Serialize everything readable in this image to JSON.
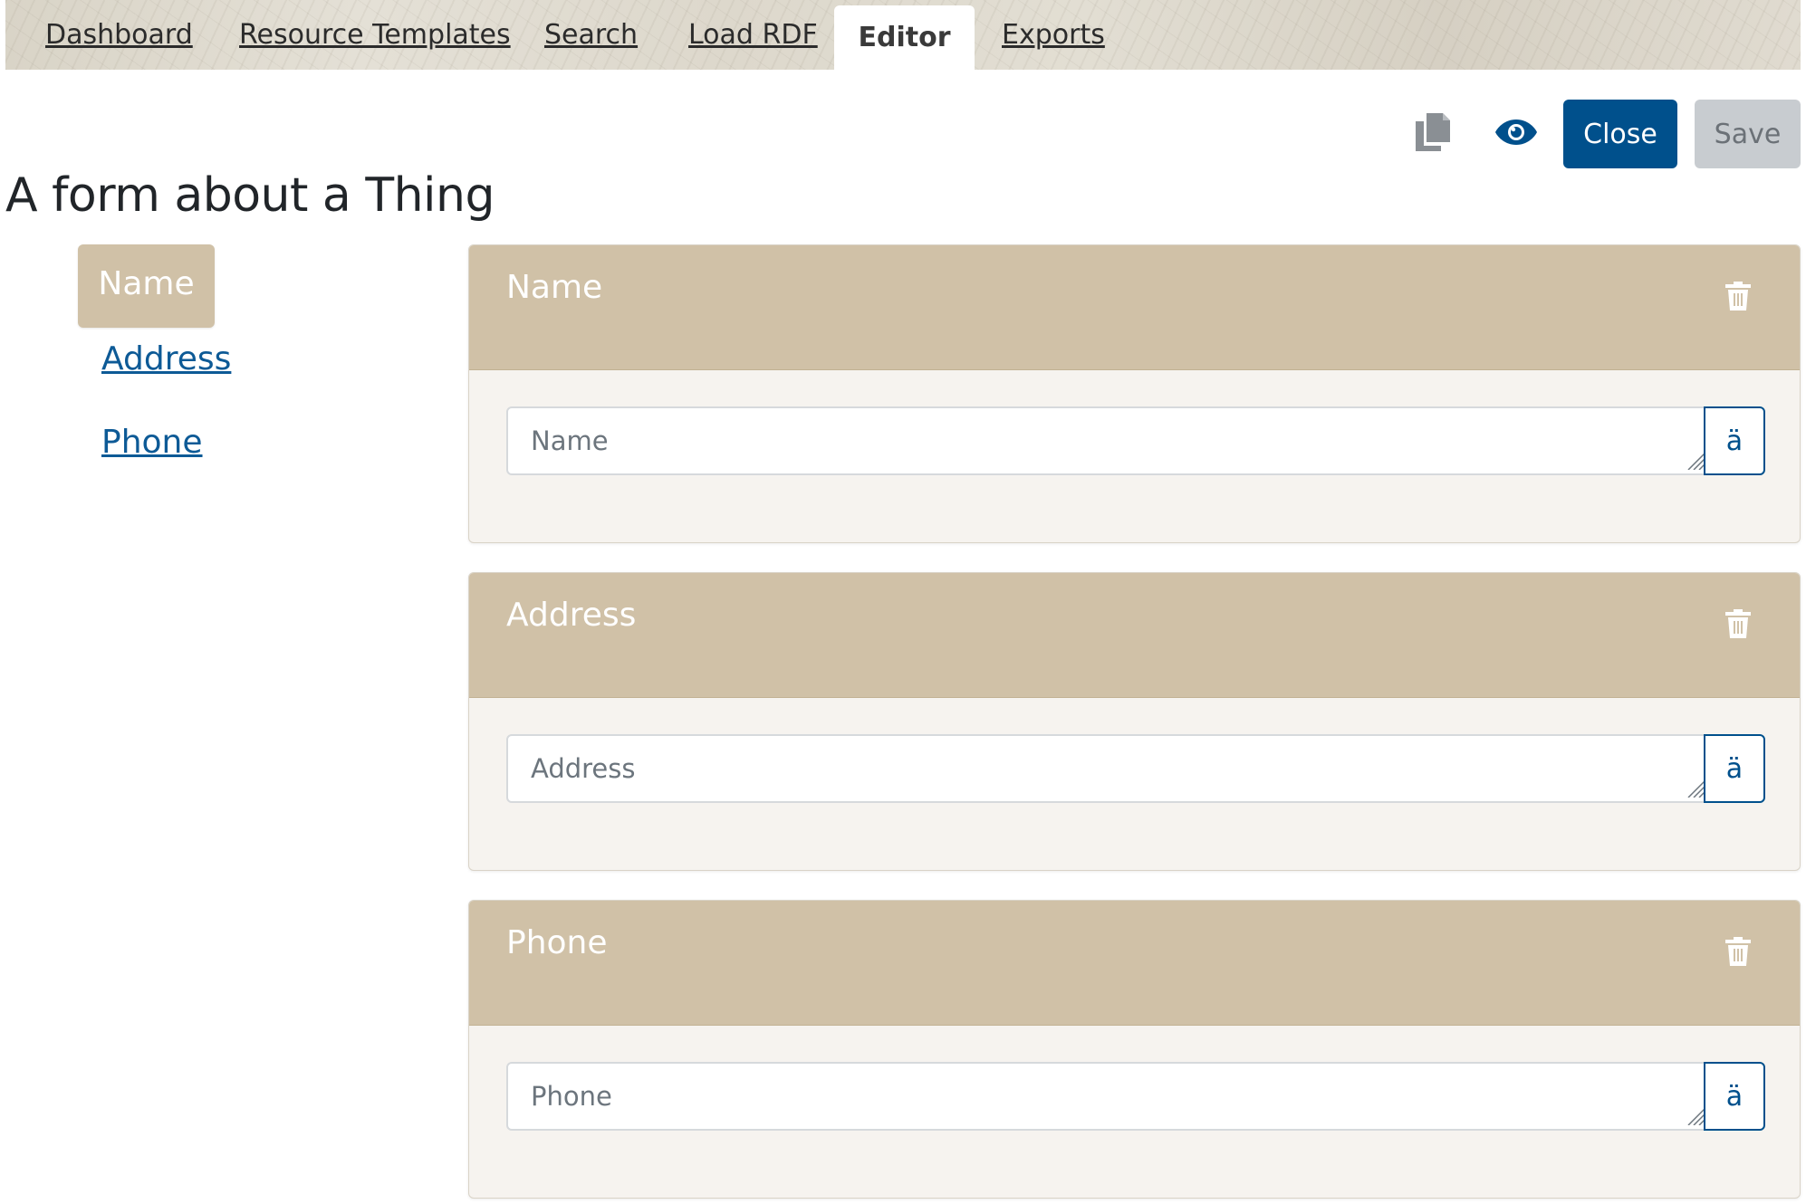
{
  "nav_tabs": [
    {
      "label": "Dashboard"
    },
    {
      "label": "Resource Templates"
    },
    {
      "label": "Search"
    },
    {
      "label": "Load RDF"
    },
    {
      "label": "Editor"
    },
    {
      "label": "Exports"
    }
  ],
  "active_tab": "Editor",
  "toolbar": {
    "copy_icon": "copy-icon",
    "preview_icon": "eye-icon",
    "close_label": "Close",
    "save_label": "Save"
  },
  "page_title": "A form about a Thing",
  "sidebar": {
    "items": [
      {
        "label": "Name",
        "active": true
      },
      {
        "label": "Address",
        "active": false
      },
      {
        "label": "Phone",
        "active": false
      }
    ]
  },
  "panels": [
    {
      "title": "Name",
      "placeholder": "Name",
      "lang_label": "ä"
    },
    {
      "title": "Address",
      "placeholder": "Address",
      "lang_label": "ä"
    },
    {
      "title": "Phone",
      "placeholder": "Phone",
      "lang_label": "ä"
    }
  ],
  "colors": {
    "accent": "#00508c",
    "panel_header": "#d0c1a7",
    "link": "#0d5a96",
    "save_disabled": "#c8ccd0"
  }
}
